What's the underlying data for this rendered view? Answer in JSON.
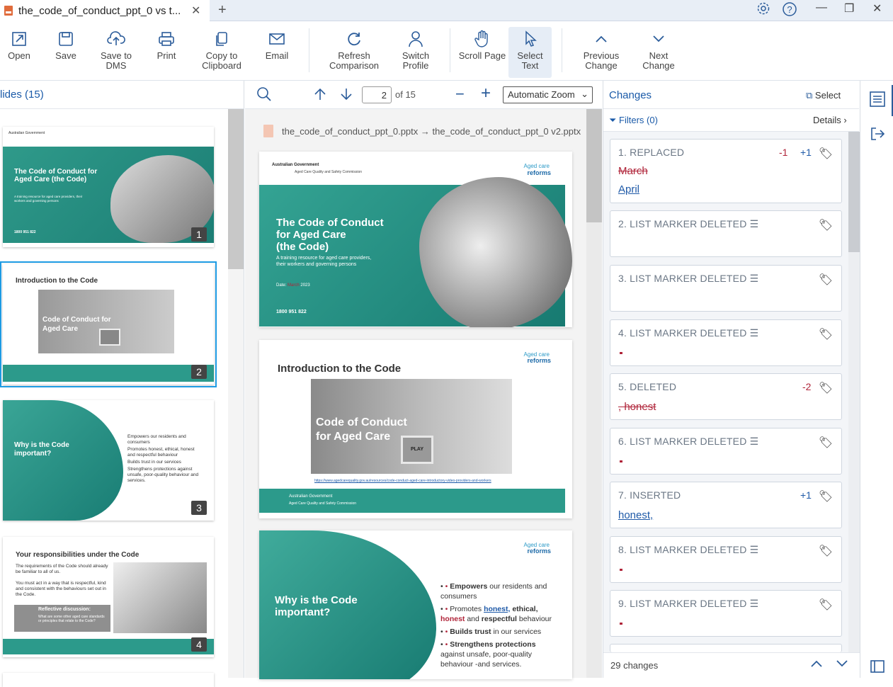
{
  "tab": {
    "title": "the_code_of_conduct_ppt_0 vs t...",
    "close": "✕"
  },
  "toolbar": {
    "open": "Open",
    "save": "Save",
    "save_to_dms": "Save to DMS",
    "print": "Print",
    "copy": "Copy to Clipboard",
    "email": "Email",
    "refresh": "Refresh Comparison",
    "switch": "Switch Profile",
    "scroll": "Scroll Page",
    "select": "Select Text",
    "previous": "Previous Change",
    "next": "Next Change"
  },
  "left": {
    "header": "lides (15)"
  },
  "thumbs": {
    "t1": {
      "title": "The Code of Conduct for Aged Care (the Code)",
      "sub": "A training resource for aged care providers, their workers and governing persons",
      "num": "1",
      "phone": "1800 951 822"
    },
    "t2": {
      "title": "Introduction to the Code",
      "vid": "Code of Conduct for Aged Care",
      "num": "2"
    },
    "t3": {
      "title": "Why is the Code important?",
      "num": "3",
      "b1": "Empowers our residents and consumers",
      "b2": "Promotes honest, ethical, honest and respectful behaviour",
      "b3": "Builds trust in our services",
      "b4": "Strengthens protections against unsafe, poor-quality behaviour and services."
    },
    "t4": {
      "title": "Your responsibilities under the Code",
      "num": "4",
      "p1": "The requirements of the Code should already be familiar to all of us.",
      "p2": "You must act in a way that is respectful, kind and consistent with the behaviours set out in the Code.",
      "box": "Reflective discussion:",
      "q": "What are some other aged care standards or principles that relate to the Code?"
    }
  },
  "center": {
    "page": "2",
    "of": "of 15",
    "zoom": "Automatic Zoom",
    "file": "the_code_of_conduct_ppt_0.pptx → the_code_of_conduct_ppt_0 v2.pptx",
    "gov": "Australian Government",
    "comm": "Aged Care Quality and Safety Commission",
    "logo_top": "Aged care",
    "logo_bot": "reforms",
    "s1": {
      "title1": "The Code of Conduct",
      "title2": "for Aged Care",
      "title3": "(the Code)",
      "sub": "A training resource for aged care providers, their workers and governing persons",
      "date": "Date:",
      "month": "March",
      "year": "2023",
      "phone": "1800 951 822"
    },
    "s2": {
      "title": "Introduction to the Code",
      "vid1": "Code of Conduct",
      "vid2": "for Aged Care",
      "play": "PLAY",
      "link": "https://www.agedcarequality.gov.au/resources/code-conduct-aged-care-introductory-video-providers-and-workers"
    },
    "s3": {
      "title1": "Why is the Code",
      "title2": "important?",
      "b1a": "Empowers",
      "b1b": " our residents and consumers",
      "b2a": "Promotes ",
      "b2b": "honest,",
      "b2c": " ethical,",
      "b2d": "honest",
      "b2e": " and ",
      "b2f": "respectful",
      "b2g": " behaviour",
      "b3a": "Builds trust",
      "b3b": " in our services",
      "b4a": "Strengthens protections",
      "b4b": " against unsafe, poor-quality behaviour -and services."
    }
  },
  "changes": {
    "header": "Changes",
    "select": "Select",
    "filters": "Filters (0)",
    "details": "Details",
    "footer": "29 changes",
    "items": [
      {
        "title": "1. REPLACED",
        "minus": "-1",
        "plus": "+1",
        "del": "March",
        "ins": "April"
      },
      {
        "title": "2. LIST MARKER DELETED"
      },
      {
        "title": "3. LIST MARKER DELETED"
      },
      {
        "title": "4. LIST MARKER DELETED"
      },
      {
        "title": "5. DELETED",
        "minus": "-2",
        "del": ", honest"
      },
      {
        "title": "6. LIST MARKER DELETED"
      },
      {
        "title": "7. INSERTED",
        "plus": "+1",
        "ins": "honest,"
      },
      {
        "title": "8. LIST MARKER DELETED"
      },
      {
        "title": "9. LIST MARKER DELETED"
      }
    ]
  }
}
